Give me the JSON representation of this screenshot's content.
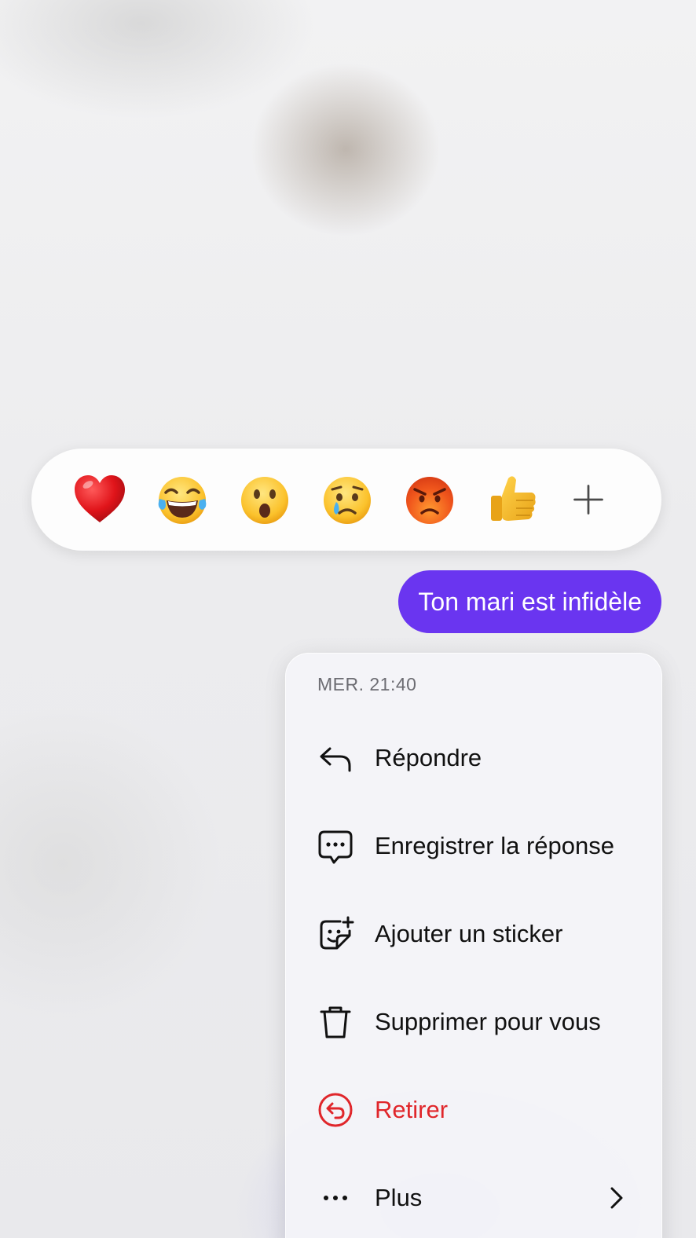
{
  "reactions": {
    "emojis": [
      {
        "icon": "red-heart-emoji",
        "glyph": "❤"
      },
      {
        "icon": "tears-of-joy-emoji",
        "glyph": "😂"
      },
      {
        "icon": "open-mouth-emoji",
        "glyph": "😮"
      },
      {
        "icon": "crying-face-emoji",
        "glyph": "😢"
      },
      {
        "icon": "angry-face-emoji",
        "glyph": "😡"
      },
      {
        "icon": "thumbs-up-emoji",
        "glyph": "👍"
      }
    ],
    "more_icon": "plus-icon"
  },
  "message": {
    "text": "Ton mari est infidèle",
    "bubble_color": "#6a35f0"
  },
  "menu": {
    "timestamp": "MER. 21:40",
    "items": [
      {
        "label": "Répondre",
        "icon": "reply-arrow-icon"
      },
      {
        "label": "Enregistrer la réponse",
        "icon": "chat-bubble-dots-icon"
      },
      {
        "label": "Ajouter un sticker",
        "icon": "sticker-add-icon"
      },
      {
        "label": "Supprimer pour vous",
        "icon": "trash-icon"
      },
      {
        "label": "Retirer",
        "icon": "unsend-icon",
        "color": "#e0262b"
      },
      {
        "label": "Plus",
        "icon": "more-dots-icon",
        "trailing_icon": "chevron-right-icon"
      }
    ]
  }
}
